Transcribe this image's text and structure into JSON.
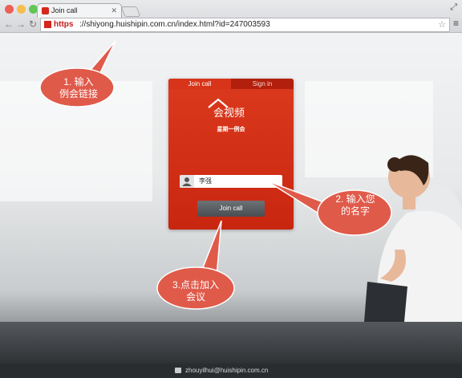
{
  "browser": {
    "tab_title": "Join call",
    "url_scheme": "https",
    "url_rest": "://shiyong.huishipin.com.cn/index.html?id=247003593"
  },
  "login_card": {
    "tabs": [
      "Join call",
      "Sign in"
    ],
    "logo_text": "会视频",
    "meeting_name": "星期一例会",
    "name_value": "李强",
    "join_button": "Join call"
  },
  "callouts": [
    {
      "text": "1. 输入例会链接"
    },
    {
      "text": "2. 输入您的名字"
    },
    {
      "text": "3.点击加入会议"
    }
  ],
  "footer": {
    "email": "zhouyilhui@huishipin.com.cn"
  },
  "colors": {
    "brand_red": "#d7331a",
    "callout_red": "#e05a4a"
  }
}
